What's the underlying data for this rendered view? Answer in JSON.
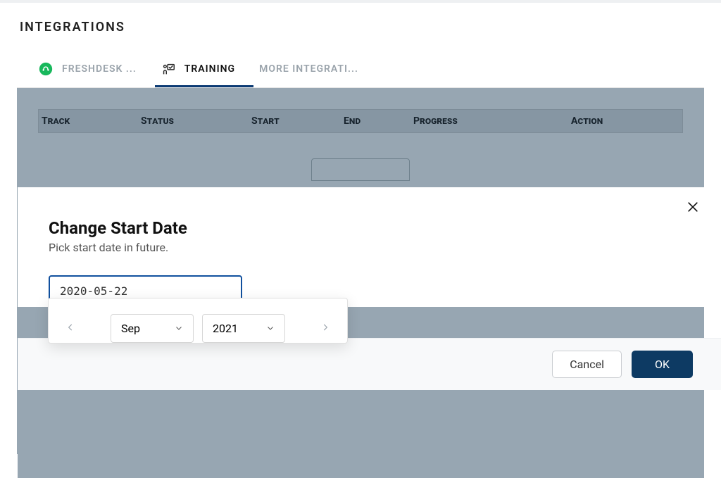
{
  "page_title": "INTEGRATIONS",
  "tabs": [
    {
      "label": "FRESHDESK ..."
    },
    {
      "label": "TRAINING"
    },
    {
      "label": "MORE INTEGRATI..."
    }
  ],
  "table": {
    "headers": {
      "track": "Track",
      "status": "Status",
      "start": "Start",
      "end": "End",
      "progress": "Progress",
      "action": "Action"
    }
  },
  "modal": {
    "title": "Change Start Date",
    "subtitle": "Pick start date in future.",
    "date_value": "2020-05-22",
    "datepicker": {
      "month": "Sep",
      "year": "2021"
    },
    "buttons": {
      "cancel": "Cancel",
      "ok": "OK"
    }
  }
}
